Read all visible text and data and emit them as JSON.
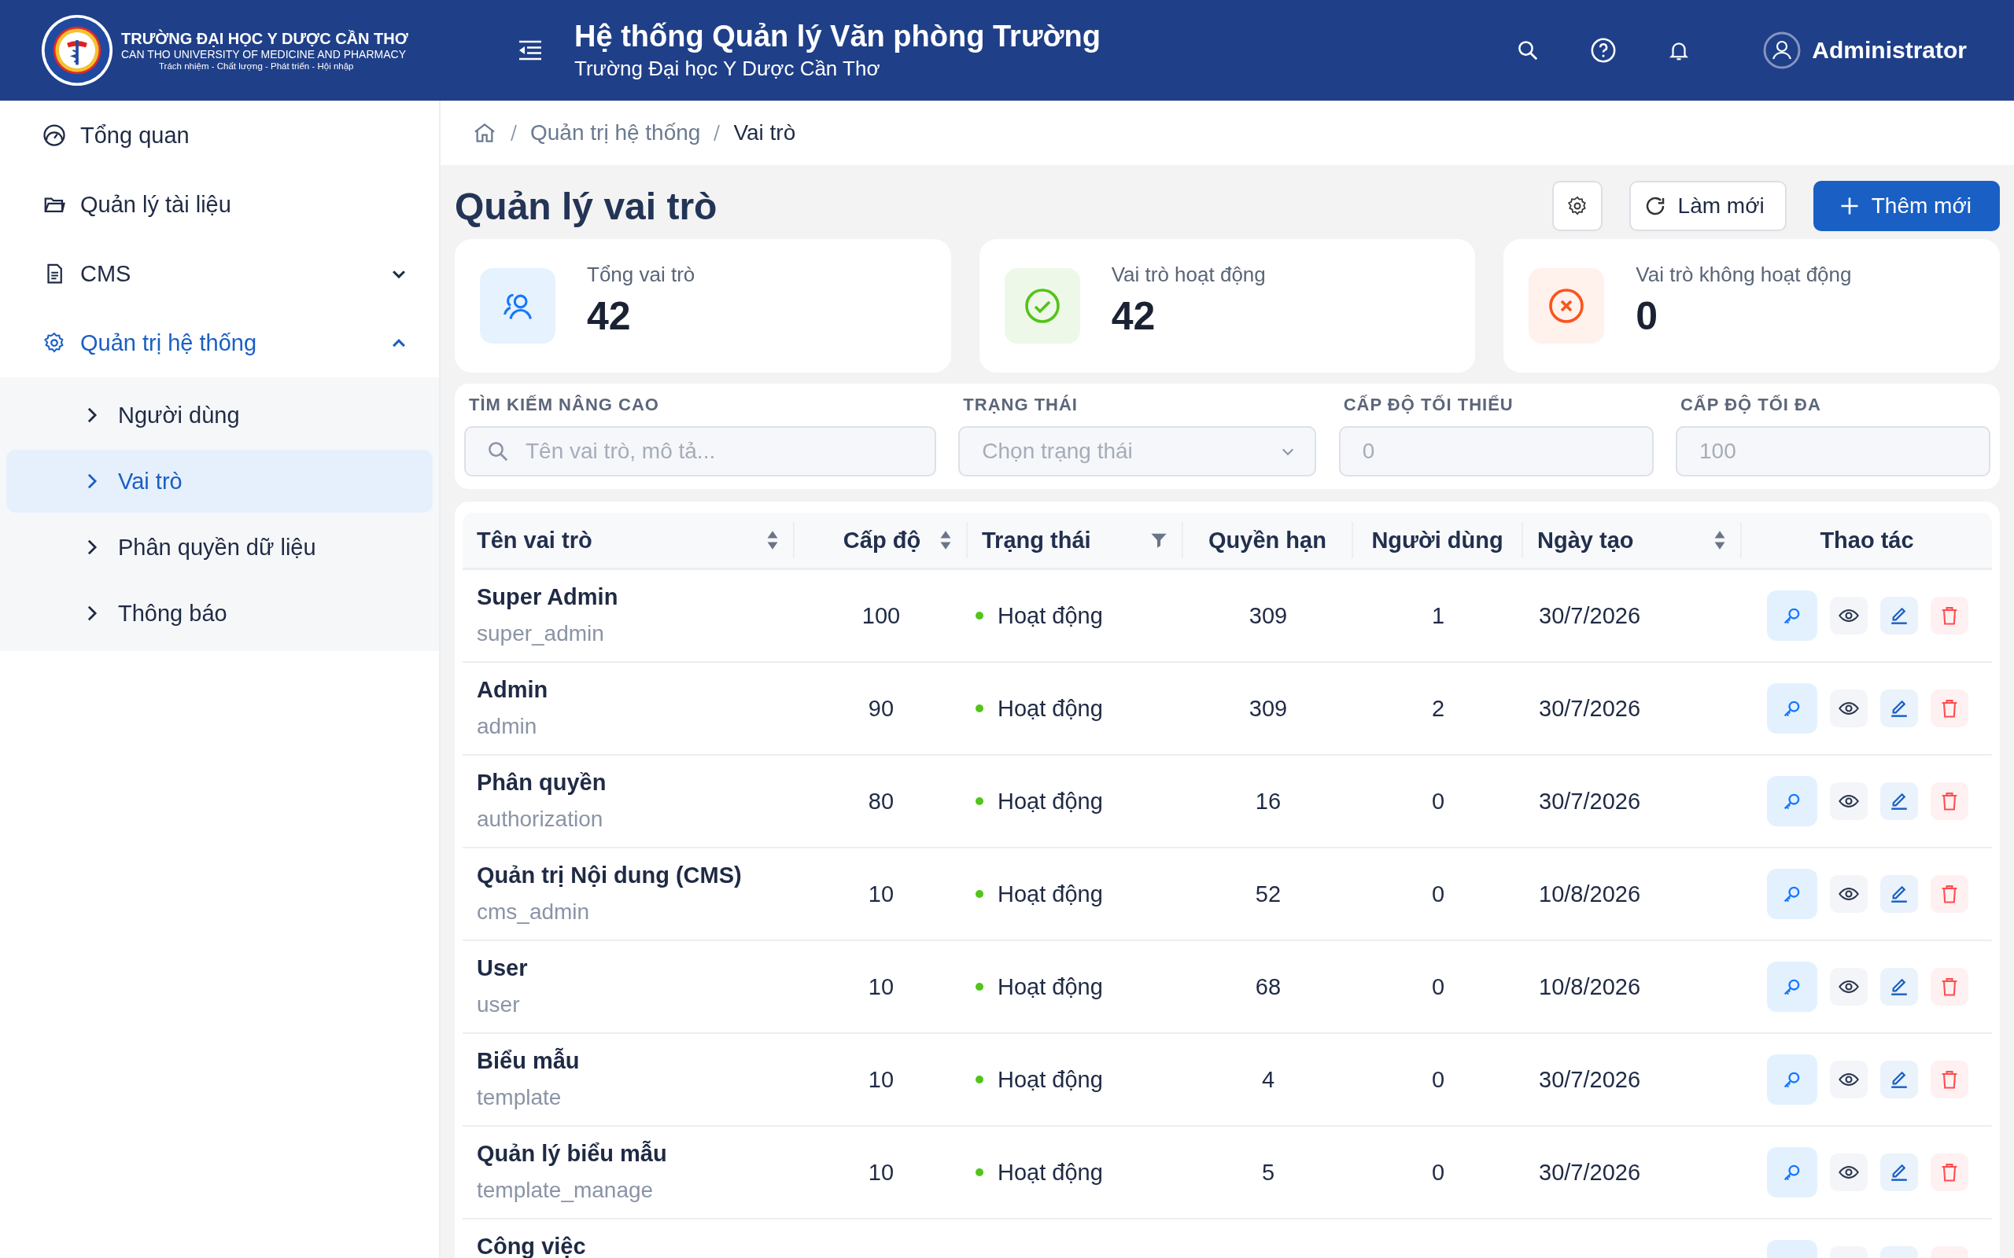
{
  "header": {
    "logo": {
      "name": "TRƯỜNG ĐẠI HỌC Y DƯỢC CẦN THƠ",
      "english": "CAN THO UNIVERSITY OF MEDICINE AND PHARMACY",
      "motto": "Trách nhiệm - Chất lượng - Phát triển - Hội nhập"
    },
    "title": "Hệ thống Quản lý Văn phòng Trường",
    "subtitle": "Trường Đại học Y Dược Cần Thơ",
    "user": "Administrator"
  },
  "sidebar": {
    "items": [
      {
        "label": "Tổng quan",
        "kind": "dashboard",
        "selected": false
      },
      {
        "label": "Quản lý tài liệu",
        "kind": "folder",
        "selected": false
      },
      {
        "label": "CMS",
        "kind": "file",
        "selected": false,
        "expanded": false
      },
      {
        "label": "Quản trị hệ thống",
        "kind": "gear",
        "selected": true,
        "expanded": true,
        "children": [
          {
            "label": "Người dùng",
            "selected": false
          },
          {
            "label": "Vai trò",
            "selected": true
          },
          {
            "label": "Phân quyền dữ liệu",
            "selected": false
          },
          {
            "label": "Thông báo",
            "selected": false
          }
        ]
      }
    ]
  },
  "breadcrumb": [
    "Quản trị hệ thống",
    "Vai trò"
  ],
  "page": {
    "title": "Quản lý vai trò",
    "refresh": "Làm mới",
    "add": "Thêm mới"
  },
  "stats": [
    {
      "label": "Tổng vai trò",
      "value": "42",
      "kind": "total"
    },
    {
      "label": "Vai trò hoạt động",
      "value": "42",
      "kind": "active"
    },
    {
      "label": "Vai trò không hoạt động",
      "value": "0",
      "kind": "inactive"
    }
  ],
  "filters": [
    {
      "label": "TÌM KIẾM NÂNG CAO",
      "placeholder": "Tên vai trò, mô tả...",
      "kind": "search"
    },
    {
      "label": "TRẠNG THÁI",
      "placeholder": "Chọn trạng thái",
      "kind": "select"
    },
    {
      "label": "CẤP ĐỘ TỐI THIỂU",
      "placeholder": "0",
      "kind": "number"
    },
    {
      "label": "CẤP ĐỘ TỐI ĐA",
      "placeholder": "100",
      "kind": "number"
    }
  ],
  "table": {
    "columns": [
      {
        "label": "Tên vai trò",
        "kind": "sort"
      },
      {
        "label": "Cấp độ",
        "kind": "sort"
      },
      {
        "label": "Trạng thái",
        "kind": "filter"
      },
      {
        "label": "Quyền hạn",
        "kind": "plain"
      },
      {
        "label": "Người dùng",
        "kind": "plain"
      },
      {
        "label": "Ngày tạo",
        "kind": "sort"
      },
      {
        "label": "Thao tác",
        "kind": "plain"
      }
    ],
    "rows": [
      {
        "name": "Super Admin",
        "code": "super_admin",
        "level": "100",
        "status": "Hoạt động",
        "color": "#52c41a",
        "permissions": "309",
        "users": "1",
        "created": "30/7/2026"
      },
      {
        "name": "Admin",
        "code": "admin",
        "level": "90",
        "status": "Hoạt động",
        "color": "#52c41a",
        "permissions": "309",
        "users": "2",
        "created": "30/7/2026"
      },
      {
        "name": "Phân quyền",
        "code": "authorization",
        "level": "80",
        "status": "Hoạt động",
        "color": "#52c41a",
        "permissions": "16",
        "users": "0",
        "created": "30/7/2026"
      },
      {
        "name": "Quản trị Nội dung (CMS)",
        "code": "cms_admin",
        "level": "10",
        "status": "Hoạt động",
        "color": "#52c41a",
        "permissions": "52",
        "users": "0",
        "created": "10/8/2026"
      },
      {
        "name": "User",
        "code": "user",
        "level": "10",
        "status": "Hoạt động",
        "color": "#52c41a",
        "permissions": "68",
        "users": "0",
        "created": "10/8/2026"
      },
      {
        "name": "Biểu mẫu",
        "code": "template",
        "level": "10",
        "status": "Hoạt động",
        "color": "#52c41a",
        "permissions": "4",
        "users": "0",
        "created": "30/7/2026"
      },
      {
        "name": "Quản lý biểu mẫu",
        "code": "template_manage",
        "level": "10",
        "status": "Hoạt động",
        "color": "#52c41a",
        "permissions": "5",
        "users": "0",
        "created": "30/7/2026"
      },
      {
        "name": "Công việc"
      }
    ]
  }
}
